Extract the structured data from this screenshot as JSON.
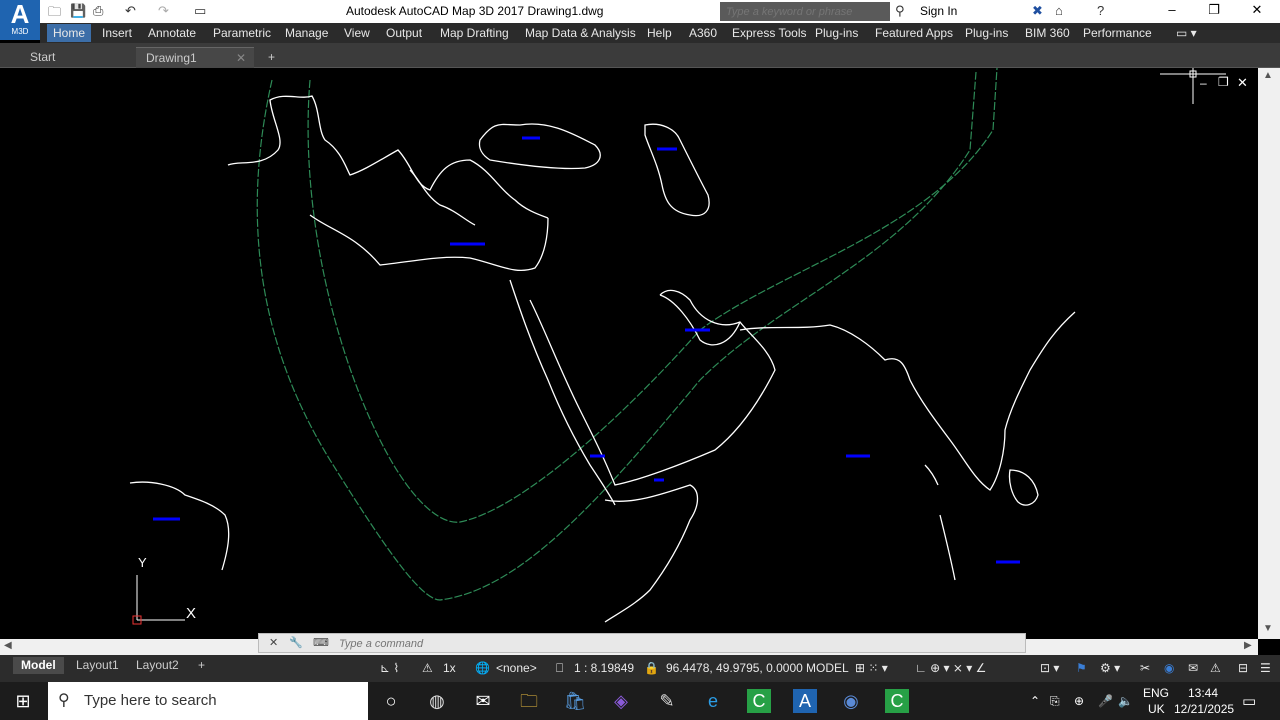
{
  "app": {
    "logo_letter": "A",
    "logo_sub": "M3D",
    "title": "Autodesk AutoCAD Map 3D 2017    Drawing1.dwg",
    "search_placeholder": "Type a keyword or phrase",
    "signin_label": "Sign In"
  },
  "menu": [
    {
      "label": "Home"
    },
    {
      "label": "Insert"
    },
    {
      "label": "Annotate"
    },
    {
      "label": "Parametric"
    },
    {
      "label": "Manage"
    },
    {
      "label": "View"
    },
    {
      "label": "Output"
    },
    {
      "label": "Map Drafting"
    },
    {
      "label": "Map Data & Analysis"
    },
    {
      "label": "Help"
    },
    {
      "label": "A360"
    },
    {
      "label": "Express Tools"
    },
    {
      "label": "Plug-ins"
    },
    {
      "label": "Featured Apps"
    },
    {
      "label": "Plug-ins"
    },
    {
      "label": "BIM 360"
    },
    {
      "label": "Performance"
    }
  ],
  "doc_tabs": {
    "start": "Start",
    "drawing": "Drawing1"
  },
  "ucs": {
    "y_label": "Y",
    "x_label": "X"
  },
  "command": {
    "placeholder": "Type a command"
  },
  "layout_tabs": {
    "model": "Model",
    "layout1": "Layout1",
    "layout2": "Layout2"
  },
  "status": {
    "scale_factor": "1x",
    "coord_system": "<none>",
    "scale": "1 : 8.19849",
    "coordinates": "96.4478, 49.9795, 0.0000",
    "model_label": "MODEL"
  },
  "taskbar": {
    "search_placeholder": "Type here to search",
    "lang_top": "ENG",
    "lang_bottom": "UK",
    "time": "13:44",
    "date": "12/21/2025"
  },
  "colors": {
    "accent": "#3c6ea8",
    "coastline": "#ffffff",
    "buffer_line": "#2e8b57",
    "label_marks": "#0000ff"
  }
}
